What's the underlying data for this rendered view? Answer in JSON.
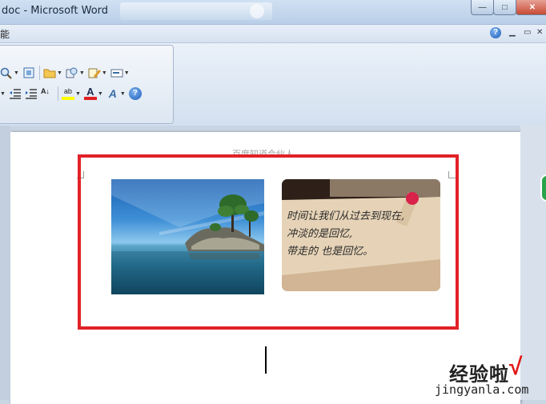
{
  "window": {
    "title": "doc - Microsoft Word",
    "minimize_label": "—",
    "maximize_label": "□",
    "close_label": "✕"
  },
  "menu": {
    "partial_label": "能",
    "help_glyph": "?",
    "restore_label": "▭",
    "close_label": "✕"
  },
  "toolbar": {
    "row1": [
      "zoom-icon",
      "fit-page-icon",
      "folder-icon",
      "research-icon",
      "edit-icon",
      "textbox-icon"
    ],
    "row2": [
      "decrease-indent-icon",
      "increase-indent-icon",
      "sort-icon",
      "highlight-icon",
      "font-color-icon",
      "font-effects-icon",
      "help-icon"
    ],
    "highlight_glyph": "ab",
    "font_color_glyph": "A",
    "font_effects_glyph": "A",
    "sort_glyph": "A↓",
    "help_glyph": "?",
    "highlight_color": "#ffff00",
    "font_color": "#e02020"
  },
  "document": {
    "header_text": "百度知道合伙人",
    "selection_color": "#e12228",
    "images": [
      {
        "name": "island-seascape-photo"
      },
      {
        "name": "handwritten-note-photo",
        "handwriting": [
          "时间让我们从过去到现在,",
          "冲淡的是回忆,",
          "带走的 也是回忆。"
        ]
      }
    ]
  },
  "watermark": {
    "text": "经验啦",
    "check": "√",
    "url": "jingyanla.com"
  }
}
